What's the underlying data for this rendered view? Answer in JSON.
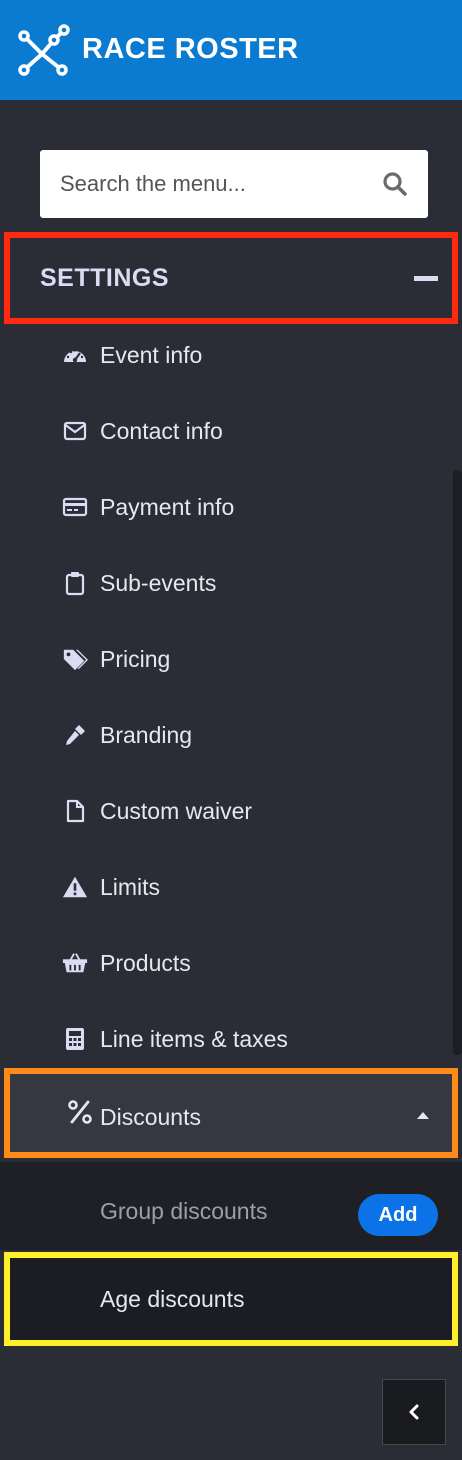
{
  "brand": {
    "name": "RACE ROSTER",
    "header_color": "#0b7bd1"
  },
  "search": {
    "placeholder": "Search the menu..."
  },
  "settings": {
    "title": "SETTINGS",
    "items": [
      {
        "label": "Event info",
        "icon": "dashboard-icon"
      },
      {
        "label": "Contact info",
        "icon": "envelope-icon"
      },
      {
        "label": "Payment info",
        "icon": "credit-card-icon"
      },
      {
        "label": "Sub-events",
        "icon": "clipboard-icon"
      },
      {
        "label": "Pricing",
        "icon": "tags-icon"
      },
      {
        "label": "Branding",
        "icon": "eyedropper-icon"
      },
      {
        "label": "Custom waiver",
        "icon": "document-icon"
      },
      {
        "label": "Limits",
        "icon": "warning-icon"
      },
      {
        "label": "Products",
        "icon": "basket-icon"
      },
      {
        "label": "Line items & taxes",
        "icon": "calculator-icon"
      }
    ]
  },
  "discounts": {
    "label": "Discounts",
    "icon": "percent-icon",
    "expanded": true,
    "sub_items": [
      {
        "label": "Group discounts",
        "action_label": "Add"
      },
      {
        "label": "Age discounts"
      }
    ]
  },
  "highlights": {
    "settings": "#ff2a10",
    "discounts": "#ff8a1a",
    "age_discounts": "#fff02a"
  }
}
